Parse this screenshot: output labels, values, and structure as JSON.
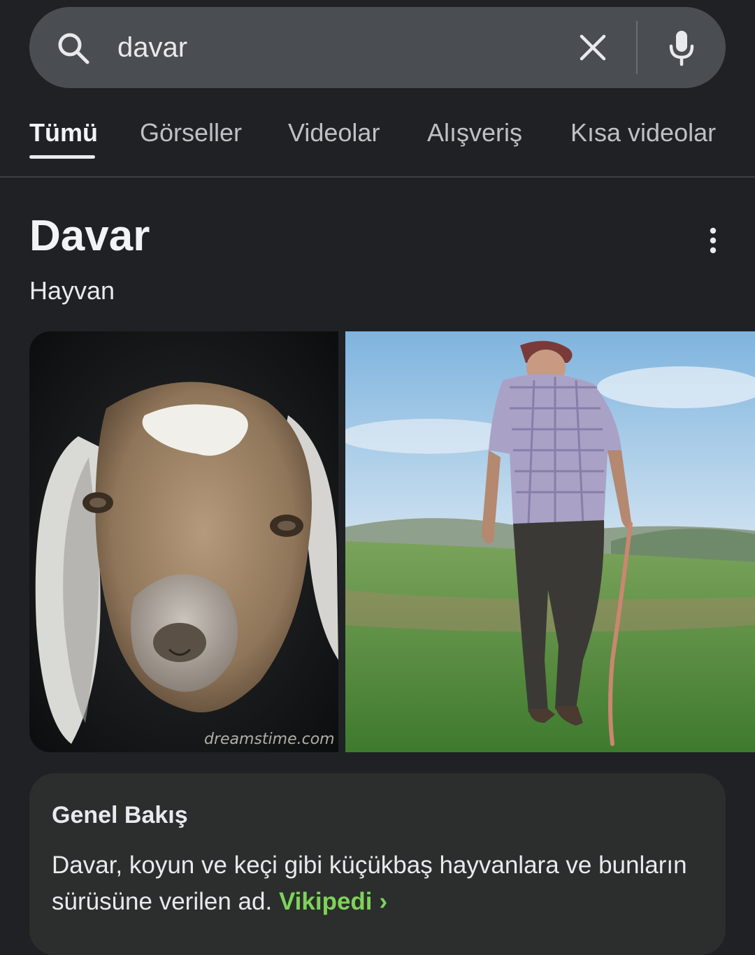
{
  "search": {
    "query": "davar",
    "icons": [
      "search-icon",
      "clear-icon",
      "mic-icon"
    ]
  },
  "tabs": [
    {
      "label": "Tümü",
      "active": true
    },
    {
      "label": "Görseller",
      "active": false
    },
    {
      "label": "Videolar",
      "active": false
    },
    {
      "label": "Alışveriş",
      "active": false
    },
    {
      "label": "Kısa videolar",
      "active": false
    }
  ],
  "entity": {
    "title": "Davar",
    "subtitle": "Hayvan"
  },
  "images": {
    "goat_watermark": "dreamstime.com"
  },
  "overview": {
    "heading": "Genel Bakış",
    "text": "Davar, koyun ve keçi gibi küçükbaş hayvanlara ve bunların sürüsüne verilen ad.",
    "source_link": "Vikipedi",
    "source_chevron": "›"
  },
  "colors": {
    "background": "#1f2125",
    "search_bar": "#4a4d51",
    "card": "#2b2e2c",
    "link": "#7ed35a"
  }
}
